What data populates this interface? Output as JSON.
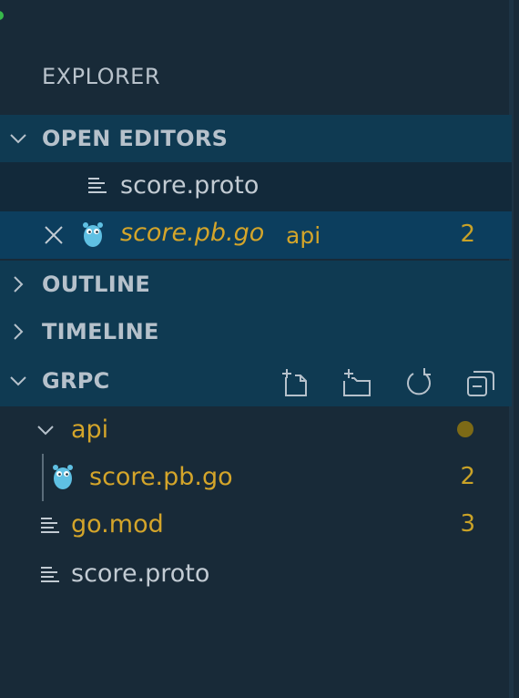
{
  "explorer": {
    "title": "EXPLORER"
  },
  "sections": {
    "open_editors": {
      "label": "OPEN EDITORS"
    },
    "outline": {
      "label": "OUTLINE"
    },
    "timeline": {
      "label": "TIMELINE"
    },
    "grpc": {
      "label": "GRPC"
    }
  },
  "open_editors": [
    {
      "name": "score.proto",
      "icon": "lines-icon"
    },
    {
      "name": "score.pb.go",
      "description": "api",
      "problems": "2",
      "icon": "gopher-icon"
    }
  ],
  "tree": {
    "folder": {
      "name": "api"
    },
    "files": [
      {
        "name": "score.pb.go",
        "problems": "2",
        "icon": "gopher-icon"
      },
      {
        "name": "go.mod",
        "problems": "3",
        "icon": "lines-icon"
      },
      {
        "name": "score.proto",
        "icon": "lines-icon"
      }
    ]
  },
  "toolbar": [
    {
      "name": "new-file-icon"
    },
    {
      "name": "new-folder-icon"
    },
    {
      "name": "refresh-icon"
    },
    {
      "name": "collapse-all-icon"
    }
  ],
  "colors": {
    "background": "#182a38",
    "section_header": "#0f3a52",
    "open_editors_bg": "#12293a",
    "selected_row": "#0c3e5e",
    "modified_yellow": "#d4a52a",
    "gopher_blue": "#5fc0e3"
  }
}
